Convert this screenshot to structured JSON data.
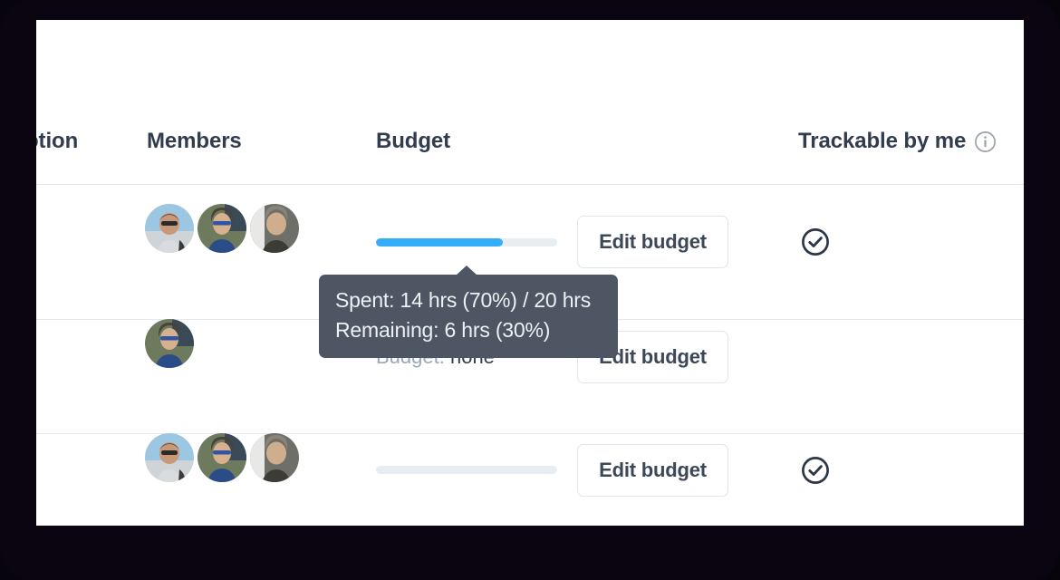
{
  "page": {
    "background_color": "#0a0510",
    "card_background": "#ffffff"
  },
  "table": {
    "columns": [
      {
        "key": "description",
        "label": "otion",
        "full_label": "Description"
      },
      {
        "key": "members",
        "label": "Members"
      },
      {
        "key": "budget",
        "label": "Budget"
      },
      {
        "key": "trackable",
        "label": "Trackable by me",
        "icon": "info-circle-icon"
      }
    ],
    "rows": [
      {
        "id": "row-1",
        "members": [
          {
            "name": "member-avatar-1",
            "bg": "#8fbfdd",
            "skin": "#c99878",
            "shirt": "#cfd3d6",
            "hair": "#6a5744"
          },
          {
            "name": "member-avatar-2",
            "bg": "#5c6b52",
            "skin": "#d7b08d",
            "shirt": "#2b4d87",
            "hair": "#4a4238"
          },
          {
            "name": "member-avatar-3",
            "bg": "#6f6f6a",
            "skin": "#cfae8e",
            "shirt": "#3c3b36",
            "hair": "#8a8378"
          }
        ],
        "budget": {
          "type": "progress",
          "percent": 70,
          "fill_color": "#35aefa",
          "track_color": "#e8edf2"
        },
        "edit_button_label": "Edit budget",
        "trackable": true,
        "trackable_icon": "check-circle-icon"
      },
      {
        "id": "row-2",
        "members": [
          {
            "name": "member-avatar-2",
            "bg": "#5c6b52",
            "skin": "#d7b08d",
            "shirt": "#2b4d87",
            "hair": "#4a4238"
          }
        ],
        "budget": {
          "type": "none",
          "label": "Budget:",
          "value": "none"
        },
        "edit_button_label": "Edit budget",
        "trackable": false,
        "trackable_icon": null
      },
      {
        "id": "row-3",
        "members": [
          {
            "name": "member-avatar-1",
            "bg": "#8fbfdd",
            "skin": "#c99878",
            "shirt": "#cfd3d6",
            "hair": "#6a5744"
          },
          {
            "name": "member-avatar-2",
            "bg": "#5c6b52",
            "skin": "#d7b08d",
            "shirt": "#2b4d87",
            "hair": "#4a4238"
          },
          {
            "name": "member-avatar-3",
            "bg": "#6f6f6a",
            "skin": "#cfae8e",
            "shirt": "#3c3b36",
            "hair": "#8a8378"
          }
        ],
        "budget": {
          "type": "progress",
          "percent": 0,
          "fill_color": "#35aefa",
          "track_color": "#e8edf2"
        },
        "edit_button_label": "Edit budget",
        "trackable": true,
        "trackable_icon": "check-circle-icon"
      }
    ]
  },
  "tooltip": {
    "visible": true,
    "background_color": "#4d5662",
    "text_color": "#eef1f4",
    "lines": [
      "Spent: 14 hrs (70%) / 20 hrs",
      "Remaining: 6 hrs (30%)"
    ],
    "spent_hours": 14,
    "spent_percent": 70,
    "total_hours": 20,
    "remaining_hours": 6,
    "remaining_percent": 30
  }
}
